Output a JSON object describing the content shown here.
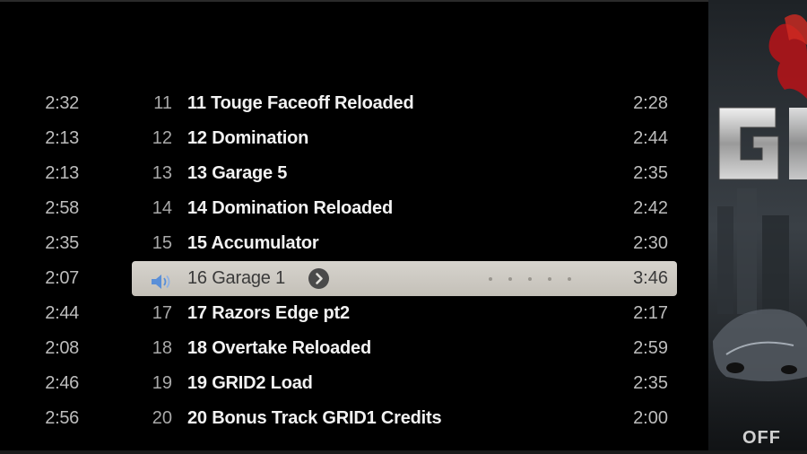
{
  "left_column": {
    "durations": [
      "2:32",
      "2:13",
      "2:13",
      "2:58",
      "2:35",
      "2:07",
      "2:44",
      "2:08",
      "2:46",
      "2:56"
    ]
  },
  "tracks": [
    {
      "number": "11",
      "title": "11 Touge Faceoff Reloaded",
      "duration": "2:28",
      "playing": false
    },
    {
      "number": "12",
      "title": "12 Domination",
      "duration": "2:44",
      "playing": false
    },
    {
      "number": "13",
      "title": "13 Garage 5",
      "duration": "2:35",
      "playing": false
    },
    {
      "number": "14",
      "title": "14 Domination Reloaded",
      "duration": "2:42",
      "playing": false
    },
    {
      "number": "15",
      "title": "15 Accumulator",
      "duration": "2:30",
      "playing": false
    },
    {
      "number": "",
      "title": "16 Garage 1",
      "duration": "3:46",
      "playing": true,
      "rating_stars": 0
    },
    {
      "number": "17",
      "title": "17 Razors Edge pt2",
      "duration": "2:17",
      "playing": false
    },
    {
      "number": "18",
      "title": "18 Overtake Reloaded",
      "duration": "2:59",
      "playing": false
    },
    {
      "number": "19",
      "title": "19 GRID2 Load",
      "duration": "2:35",
      "playing": false
    },
    {
      "number": "20",
      "title": "20 Bonus Track GRID1 Credits",
      "duration": "2:00",
      "playing": false
    }
  ],
  "icons": {
    "now_playing": "speaker-icon",
    "go_arrow": "arrow-circle-icon"
  },
  "album_art": {
    "visible_text_top": "G",
    "visible_text_bottom": "OFF"
  },
  "colors": {
    "background": "#000000",
    "playing_row": "#d0cdc6",
    "speaker_blue": "#5a8fd8"
  }
}
